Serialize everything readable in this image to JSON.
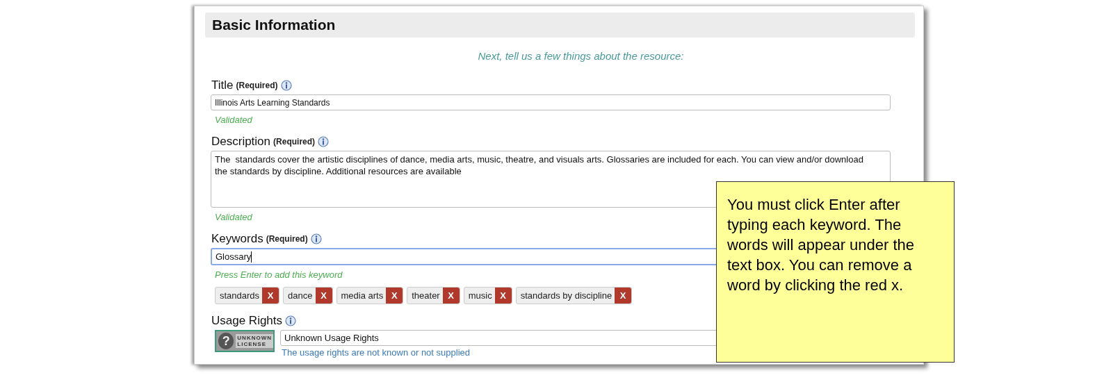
{
  "section": {
    "title": "Basic Information",
    "intro": "Next, tell us a few things about the resource:"
  },
  "fields": [
    {
      "kind": "text",
      "label": "Title",
      "required_label": "(Required)",
      "value": "Illinois Arts Learning Standards",
      "status": "Validated"
    },
    {
      "kind": "textarea",
      "label": "Description",
      "required_label": "(Required)",
      "value": "The  standards cover the artistic disciplines of dance, media arts, music, theatre, and visuals arts. Glossaries are included for each. You can view and/or download the standards by discipline. Additional resources are available",
      "status": "Validated"
    },
    {
      "kind": "keywords",
      "label": "Keywords",
      "required_label": "(Required)",
      "value": "Glossary",
      "focused": true,
      "status": "Press Enter to add this keyword",
      "tags": [
        {
          "label": "standards",
          "remove": "X"
        },
        {
          "label": "dance",
          "remove": "X"
        },
        {
          "label": "media arts",
          "remove": "X"
        },
        {
          "label": "theater",
          "remove": "X"
        },
        {
          "label": "music",
          "remove": "X"
        },
        {
          "label": "standards by discipline",
          "remove": "X"
        }
      ]
    },
    {
      "kind": "rights",
      "label": "Usage Rights",
      "badge": {
        "symbol": "?",
        "line1": "UNKNOWN",
        "line2": "LICENSE"
      },
      "value": "Unknown Usage Rights",
      "note": "The usage rights are not known or not supplied"
    }
  ],
  "callout": {
    "text": "You must click Enter after typing each keyword. The words will appear under the text box. You can remove a word by clicking the red x."
  }
}
